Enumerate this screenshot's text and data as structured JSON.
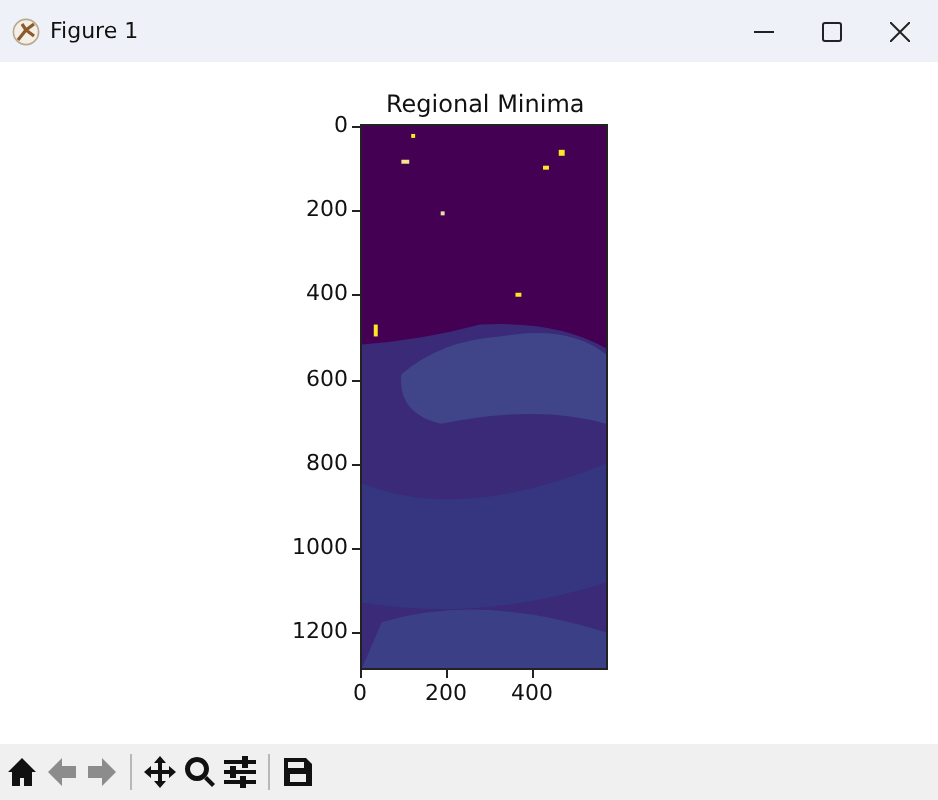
{
  "window": {
    "title": "Figure 1"
  },
  "axes": {
    "title": "Regional Minima",
    "xticks": [
      "0",
      "200",
      "400"
    ],
    "yticks": [
      "0",
      "200",
      "400",
      "600",
      "800",
      "1000",
      "1200"
    ]
  },
  "toolbar": [
    {
      "kind": "home",
      "disabled": false
    },
    {
      "kind": "back",
      "disabled": true
    },
    {
      "kind": "forward",
      "disabled": true
    },
    {
      "kind": "separator"
    },
    {
      "kind": "pan",
      "disabled": false
    },
    {
      "kind": "zoom",
      "disabled": false
    },
    {
      "kind": "configure",
      "disabled": false
    },
    {
      "kind": "separator"
    },
    {
      "kind": "save",
      "disabled": false
    }
  ]
}
